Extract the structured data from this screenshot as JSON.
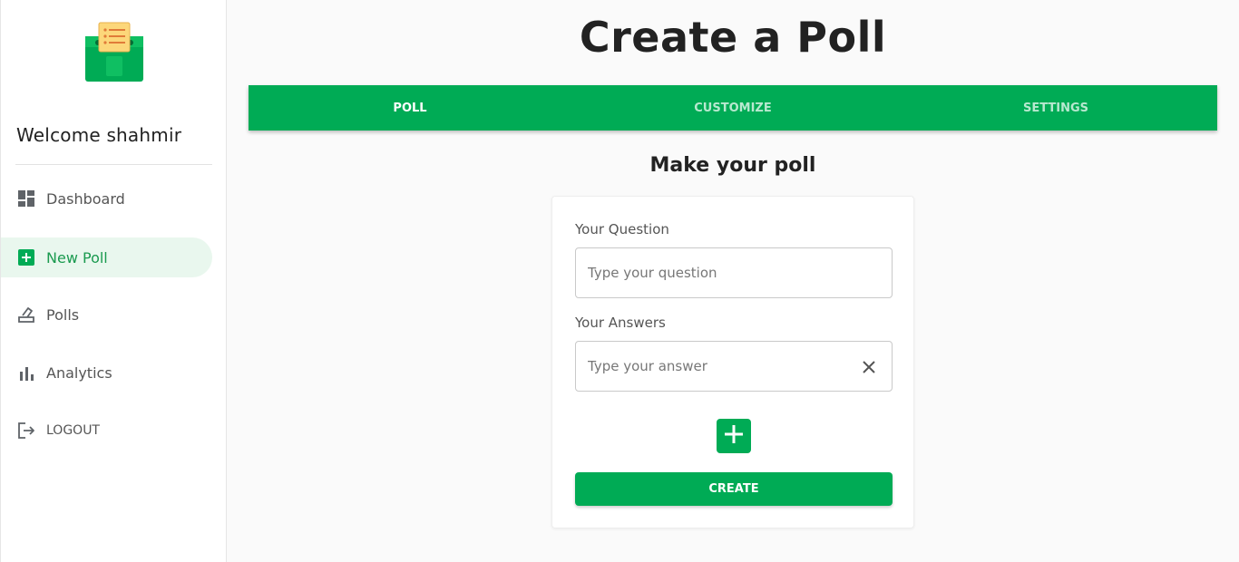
{
  "sidebar": {
    "welcome": "Welcome shahmir",
    "items": [
      {
        "label": "Dashboard",
        "icon": "dashboard-icon"
      },
      {
        "label": "New Poll",
        "icon": "add-box-icon",
        "active": true
      },
      {
        "label": "Polls",
        "icon": "ballot-icon"
      },
      {
        "label": "Analytics",
        "icon": "bar-chart-icon"
      },
      {
        "label": "LOGOUT",
        "icon": "logout-icon"
      }
    ]
  },
  "header": {
    "title": "Create a Poll"
  },
  "tabs": [
    {
      "label": "POLL",
      "active": true
    },
    {
      "label": "CUSTOMIZE"
    },
    {
      "label": "SETTINGS"
    }
  ],
  "form": {
    "section_title": "Make your poll",
    "question_label": "Your Question",
    "question_placeholder": "Type your question",
    "question_value": "",
    "answers_label": "Your Answers",
    "answer_placeholder": "Type your answer",
    "answer_value": "",
    "create_label": "CREATE"
  },
  "colors": {
    "accent": "#00ab55",
    "active_nav_bg": "#e9f7ee",
    "logo_box": "#00ab55",
    "logo_paper": "#fcd77a"
  }
}
